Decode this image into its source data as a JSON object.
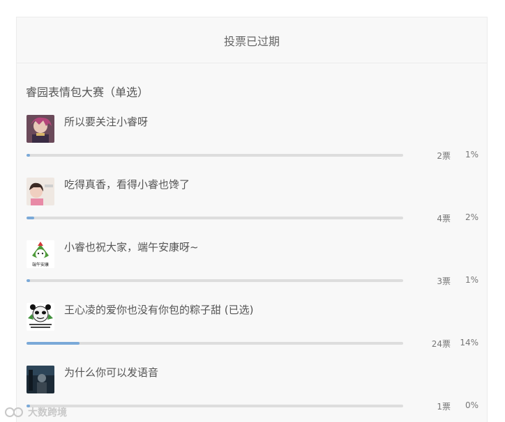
{
  "poll": {
    "status": "投票已过期",
    "title": "睿园表情包大赛（单选）",
    "options": [
      {
        "label": "所以要关注小睿呀",
        "votes": "2票",
        "percent": "1%",
        "fraction": 0.01,
        "thumb": "anime-character-thumb"
      },
      {
        "label": "吃得真香，看得小睿也馋了",
        "votes": "4票",
        "percent": "2%",
        "fraction": 0.02,
        "thumb": "child-photo-thumb"
      },
      {
        "label": "小睿也祝大家，端午安康呀~",
        "votes": "3票",
        "percent": "1%",
        "fraction": 0.01,
        "thumb": "zongzi-sticker-thumb",
        "sticker_text": "端午安康"
      },
      {
        "label": "王心凌的爱你也没有你包的粽子甜 (已选)",
        "votes": "24票",
        "percent": "14%",
        "fraction": 0.14,
        "thumb": "panda-meme-thumb"
      },
      {
        "label": "为什么你可以发语音",
        "votes": "1票",
        "percent": "0%",
        "fraction": 0.0,
        "thumb": "dark-photo-thumb"
      }
    ]
  },
  "watermark": {
    "text": "大数跨境"
  },
  "colors": {
    "bar_fill": "#7aa9d8",
    "bar_track": "#dddddd",
    "card_bg": "#f8f8f8"
  }
}
